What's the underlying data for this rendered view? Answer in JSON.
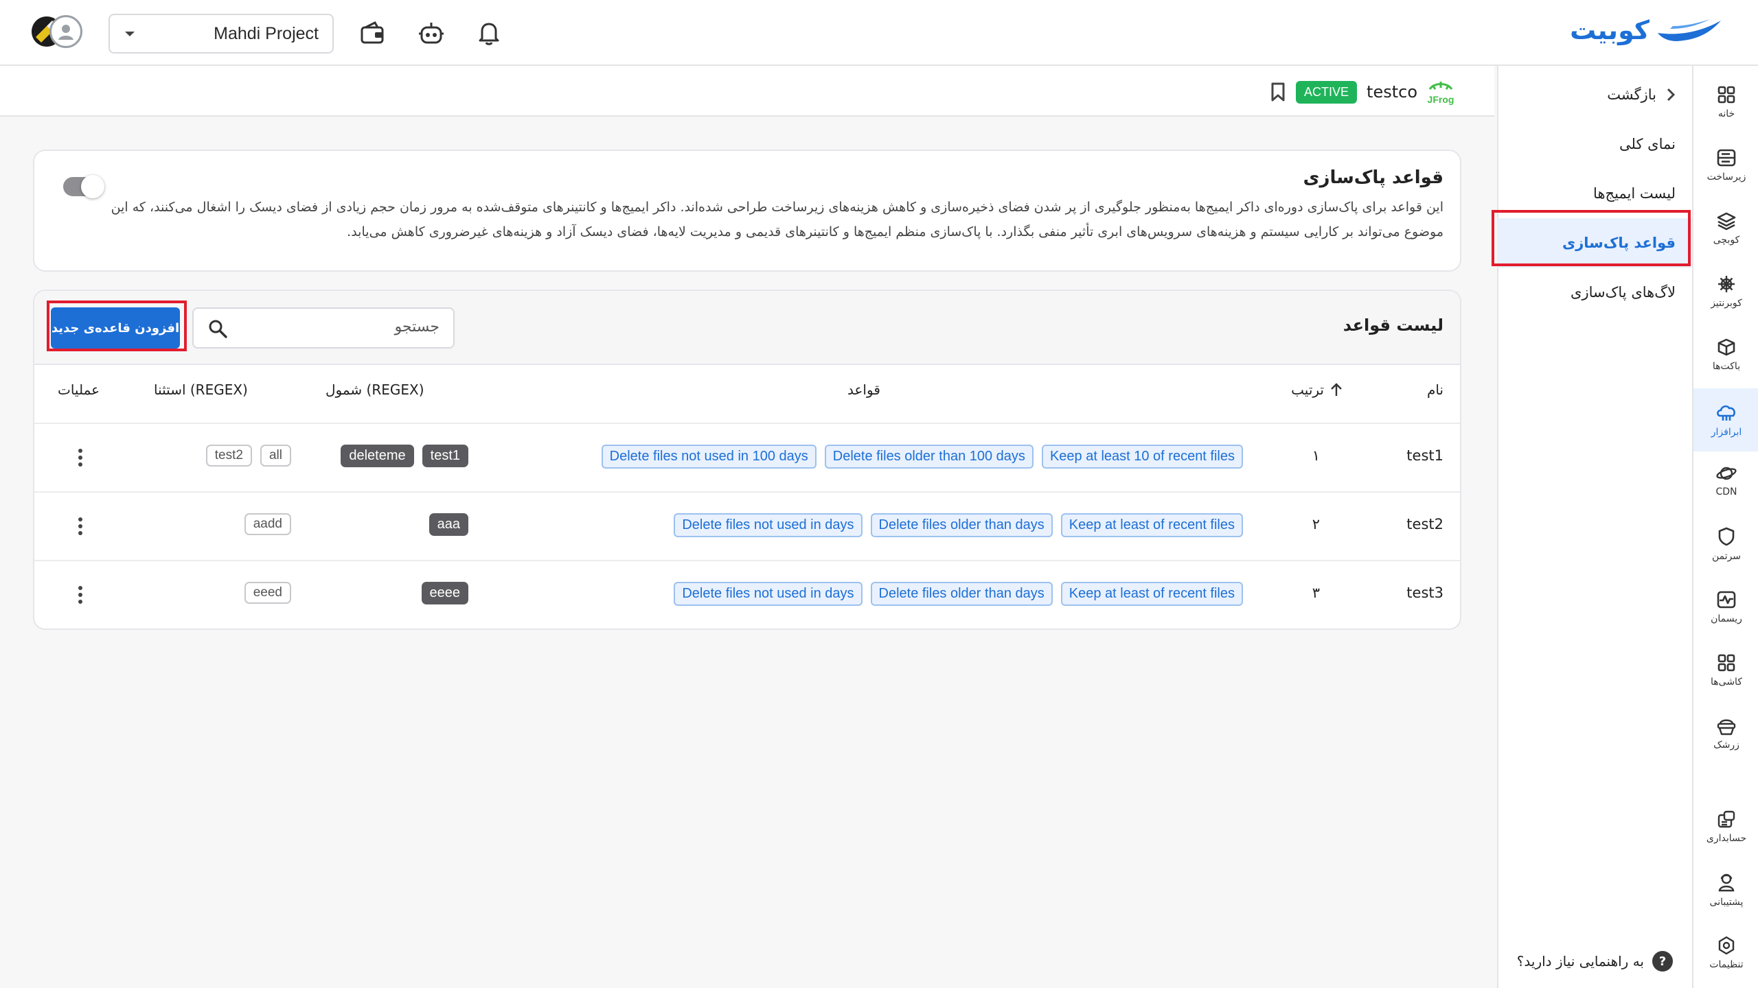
{
  "header": {
    "brand": "کوبیت",
    "project": "Mahdi Project",
    "icons": [
      "wallet-icon",
      "robot-icon",
      "bell-icon"
    ]
  },
  "rail": [
    {
      "label": "خانه",
      "icon": "grid-icon"
    },
    {
      "label": "زیرساخت",
      "icon": "server-icon"
    },
    {
      "label": "کوبچی",
      "icon": "layers-icon"
    },
    {
      "label": "کوبرنتیز",
      "icon": "helm-icon"
    },
    {
      "label": "باکت‌ها",
      "icon": "box-icon"
    },
    {
      "label": "ابرافزار",
      "icon": "cloud-icon",
      "active": true
    },
    {
      "label": "CDN",
      "icon": "planet-icon"
    },
    {
      "label": "سرتمن",
      "icon": "shield-icon"
    },
    {
      "label": "ریسمان",
      "icon": "pulse-icon"
    },
    {
      "label": "کاشی‌ها",
      "icon": "tiles-icon"
    },
    {
      "label": "زرشک",
      "icon": "basket-icon"
    },
    {
      "label": "حسابداری",
      "icon": "accounting-icon"
    },
    {
      "label": "پشتیبانی",
      "icon": "support-icon"
    },
    {
      "label": "تنظیمات",
      "icon": "settings-icon"
    }
  ],
  "subnav": {
    "back": "بازگشت",
    "items": [
      "نمای کلی",
      "لیست ایمیج‌ها",
      "قواعد پاک‌سازی",
      "لاگ‌های پاک‌سازی"
    ],
    "active_index": 2,
    "help": "به راهنمایی نیاز دارید؟"
  },
  "repo": {
    "name": "testco",
    "status": "ACTIVE",
    "logo_text": "JFrog"
  },
  "info": {
    "title": "قواعد پاک‌سازی",
    "description": "این قواعد برای پاک‌سازی دوره‌ای داکر ایمیج‌ها به‌منظور جلوگیری از پر شدن فضای ذخیره‌سازی و کاهش هزینه‌های زیرساخت طراحی شده‌اند. داکر ایمیج‌ها و کانتینرهای متوقف‌شده به مرور زمان حجم زیادی از فضای دیسک را اشغال می‌کنند، که این موضوع می‌تواند بر کارایی سیستم و هزینه‌های سرویس‌های ابری تأثیر منفی بگذارد. با پاک‌سازی منظم ایمیج‌ها و کانتینرهای قدیمی و مدیریت لایه‌ها، فضای دیسک آزاد و هزینه‌های غیرضروری کاهش می‌یابد.",
    "enabled": false
  },
  "list": {
    "title": "لیست قواعد",
    "search_placeholder": "جستجو",
    "add_button": "افزودن قاعده‌ی جدید",
    "columns": {
      "name": "نام",
      "order": "ترتیب",
      "rules": "قواعد",
      "include": "شمول (REGEX)",
      "exclude": "استثنا (REGEX)",
      "actions": "عملیات"
    },
    "rows": [
      {
        "name": "test1",
        "order": "۱",
        "rules": [
          "Keep at least 10 of recent files",
          "Delete files older than 100 days",
          "Delete files not used in 100 days"
        ],
        "include": [
          "test1",
          "deleteme"
        ],
        "exclude": [
          "all",
          "test2"
        ]
      },
      {
        "name": "test2",
        "order": "۲",
        "rules": [
          "Keep at least of recent files",
          "Delete files older than days",
          "Delete files not used in days"
        ],
        "include": [
          "aaa"
        ],
        "exclude": [
          "aadd"
        ]
      },
      {
        "name": "test3",
        "order": "۳",
        "rules": [
          "Keep at least of recent files",
          "Delete files older than days",
          "Delete files not used in days"
        ],
        "include": [
          "eeee"
        ],
        "exclude": [
          "eeed"
        ]
      }
    ]
  },
  "colors": {
    "accent": "#1d6fd6",
    "active_badge": "#1fb45a",
    "highlight_box": "#e11d2e"
  }
}
